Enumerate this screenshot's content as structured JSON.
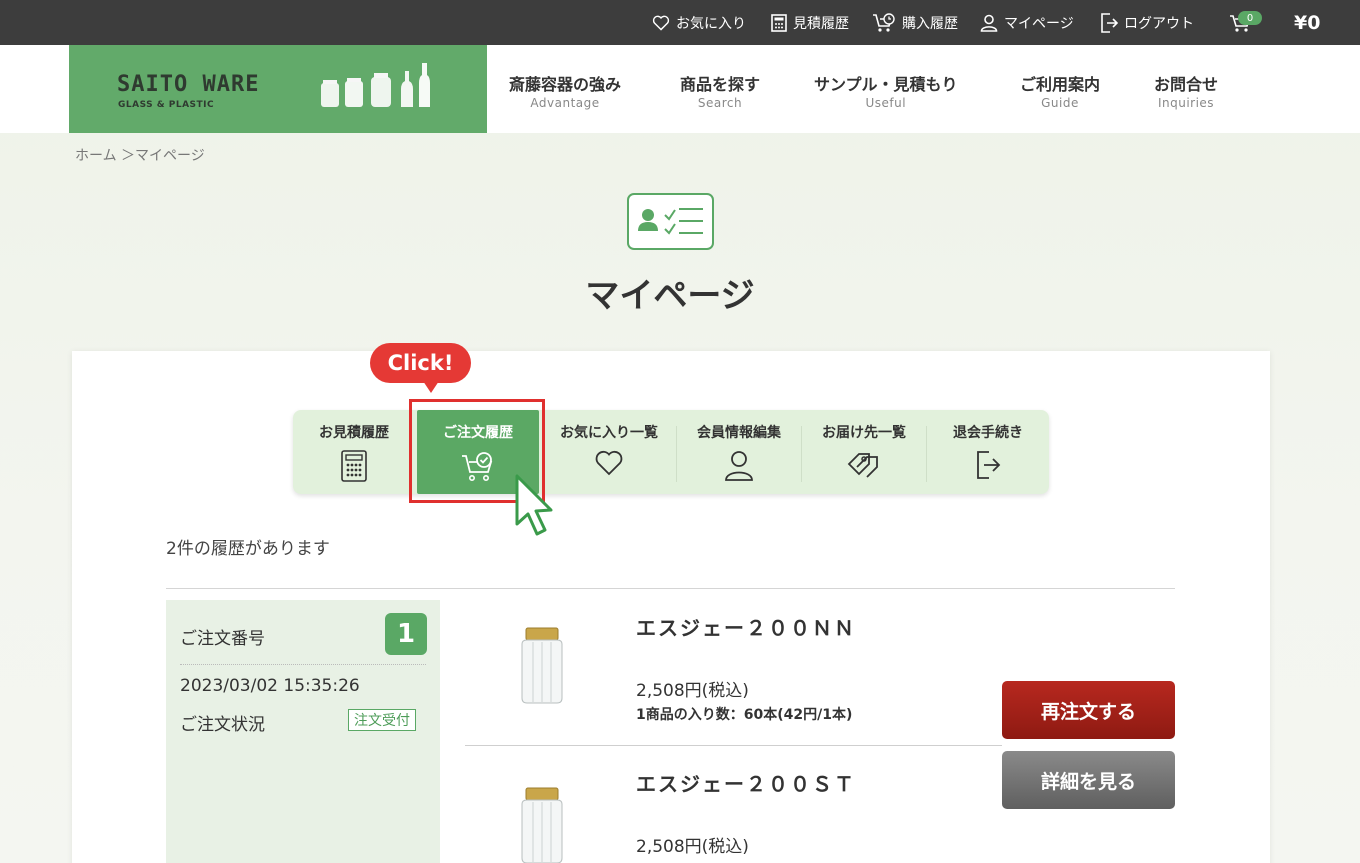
{
  "topbar": {
    "favorites": "お気に入り",
    "quotes": "見積履歴",
    "purchases": "購入履歴",
    "mypage": "マイページ",
    "logout": "ログアウト",
    "cart_count": "0",
    "cart_total": "¥0"
  },
  "logo": {
    "main": "SAITO WARE",
    "sub": "GLASS & PLASTIC"
  },
  "nav": [
    {
      "jp": "斎藤容器の強み",
      "en": "Advantage"
    },
    {
      "jp": "商品を探す",
      "en": "Search"
    },
    {
      "jp": "サンプル・見積もり",
      "en": "Useful"
    },
    {
      "jp": "ご利用案内",
      "en": "Guide"
    },
    {
      "jp": "お問合せ",
      "en": "Inquiries"
    }
  ],
  "breadcrumb": "ホーム ＞マイページ",
  "page_title": "マイページ",
  "annotation": {
    "click_label": "Click!"
  },
  "tabs": [
    {
      "label": "お見積履歴",
      "icon": "calculator-icon"
    },
    {
      "label": "ご注文履歴",
      "icon": "cart-check-icon",
      "active": true
    },
    {
      "label": "お気に入り一覧",
      "icon": "heart-icon"
    },
    {
      "label": "会員情報編集",
      "icon": "user-icon"
    },
    {
      "label": "お届け先一覧",
      "icon": "tags-icon"
    },
    {
      "label": "退会手続き",
      "icon": "logout-icon"
    }
  ],
  "history_count_text": "2件の履歴があります",
  "order": {
    "number_label": "ご注文番号",
    "number": "1",
    "datetime": "2023/03/02 15:35:26",
    "status_label": "ご注文状況",
    "status": "注文受付",
    "items": [
      {
        "name": "エスジェー２００ＮＮ",
        "price": "2,508円(税込)",
        "qty": "1商品の入り数：60本(42円/1本)"
      },
      {
        "name": "エスジェー２００ＳＴ",
        "price": "2,508円(税込)"
      }
    ],
    "reorder_button": "再注文する",
    "detail_button": "詳細を見る"
  },
  "colors": {
    "brand_green": "#5aa865",
    "reorder_red": "#a4221a",
    "annotation_red": "#e53935"
  }
}
